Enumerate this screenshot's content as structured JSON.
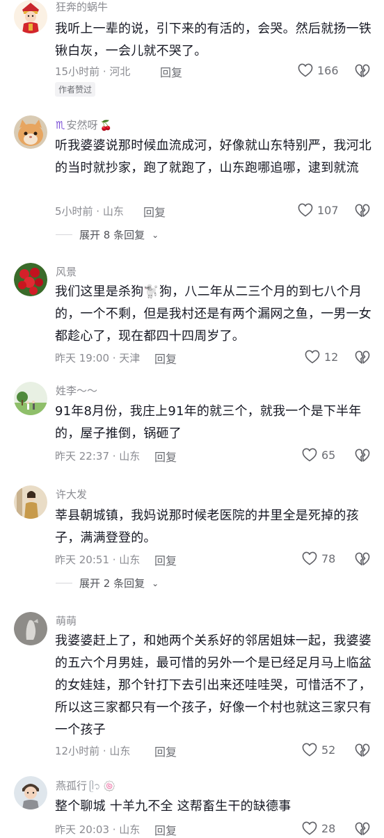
{
  "comments": [
    {
      "username": "狂奔的蜗牛",
      "text": "我听上一辈的说，引下来的有活的，会哭。然后就扬一铁锹白灰，一会儿就不哭了。",
      "time_location": "15小时前 · 河北",
      "reply_label": "回复",
      "likes": "166",
      "author_liked_label": "作者赞过"
    },
    {
      "username": "安然呀",
      "username_badge": "♏",
      "username_suffix": "🍒",
      "text": "听我婆婆说那时候血流成河，好像就山东特别严，我河北的当时就抄家，跑了就跑了，山东跑哪追哪，逮到就流",
      "time_location": "5小时前 · 山东",
      "reply_label": "回复",
      "likes": "107",
      "expand_label": "展开 8 条回复"
    },
    {
      "username": "风景",
      "text": "我们这里是杀狗🐩狗，八二年从二三个月的到七八个月的，一个不剩，但是我村还是有两个漏网之鱼，一男一女都趁心了，现在都四十四周岁了。",
      "time_location": "昨天 19:00 · 天津",
      "reply_label": "回复",
      "likes": "12"
    },
    {
      "username": "姓李～～",
      "text": "91年8月份，我庄上91年的就三个，就我一个是下半年的，屋子推倒，锅砸了",
      "time_location": "昨天 22:37 · 山东",
      "reply_label": "回复",
      "likes": "65"
    },
    {
      "username": "许大发",
      "text": "莘县朝城镇，我妈说那时候老医院的井里全是死掉的孩子，满满登登的。",
      "time_location": "昨天 20:51 · 山东",
      "reply_label": "回复",
      "likes": "78",
      "expand_label": "展开 2 条回复"
    },
    {
      "username": "萌萌",
      "text": "我婆婆赶上了，和她两个关系好的邻居姐妹一起，我婆婆的五六个月男娃，最可惜的另外一个是已经足月马上临盆的女娃娃，那个针打下去引出来还哇哇哭，可惜活不了，所以这三家都只有一个孩子，好像一个村也就这三家只有一个孩子",
      "time_location": "12小时前 · 山东",
      "reply_label": "回复",
      "likes": "52"
    },
    {
      "username": "燕孤行",
      "username_suffix": "ᥫ᭡ 🍥",
      "text": "整个聊城 十羊九不全 这帮畜生干的缺德事",
      "time_location": "昨天 20:03 · 山东",
      "reply_label": "回复",
      "likes": "28"
    }
  ]
}
